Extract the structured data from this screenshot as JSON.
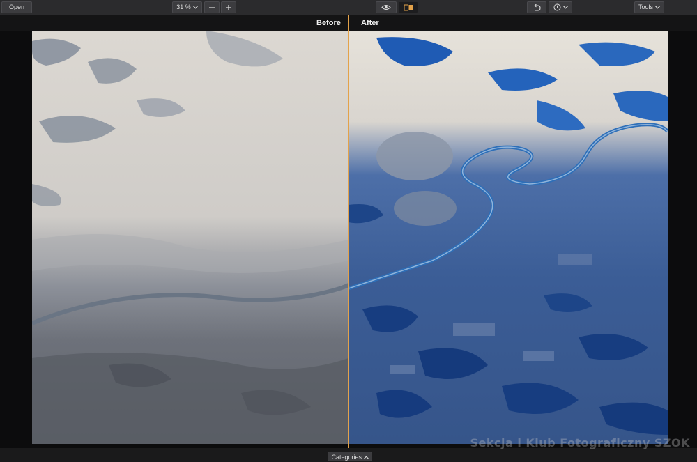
{
  "toolbar": {
    "open_label": "Open",
    "zoom_value": "31 %",
    "tools_label": "Tools"
  },
  "compare": {
    "before_label": "Before",
    "after_label": "After"
  },
  "bottom": {
    "categories_label": "Categories"
  },
  "watermark": "Sekcja i Klub Fotograficzny SZOK",
  "colors": {
    "divider": "#e3a24a",
    "toolbar_bg": "#2b2b2d"
  },
  "icons": {
    "zoom_dropdown": "chevron-down-icon",
    "zoom_out": "minus-icon",
    "zoom_in": "plus-icon",
    "preview": "eye-icon",
    "compare_split": "split-view-icon",
    "undo": "undo-icon",
    "history": "clock-icon",
    "tools_dropdown": "chevron-down-icon",
    "categories_toggle": "chevron-up-icon"
  }
}
